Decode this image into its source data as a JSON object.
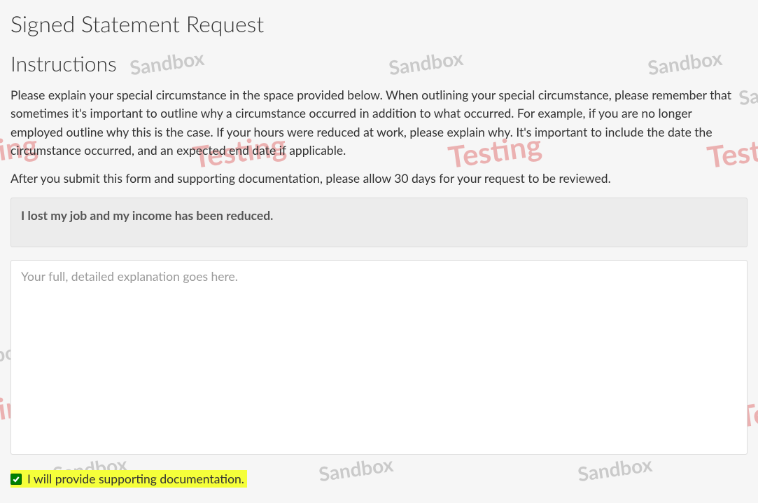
{
  "page_title": "Signed Statement Request",
  "instructions": {
    "heading": "Instructions",
    "para1": "Please explain your special circumstance in the space provided below. When outlining your special circumstance, please remember that sometimes it's important to outline why a circumstance occurred in addition to what occurred. For example, if you are no longer employed outline why this is the case. If your hours were reduced at work, please explain why. It's important to include the date the circumstance occurred, and an expected end date if applicable.",
    "para2": "After you submit this form and supporting documentation, please allow 30 days for your request to be reviewed."
  },
  "summary_box_text": "I lost my job and my income has been reduced.",
  "explanation_placeholder": "Your full, detailed explanation goes here.",
  "explanation_value": "",
  "checkbox": {
    "label": "I will provide supporting documentation.",
    "checked": true
  },
  "watermarks": {
    "sandbox": "Sandbox",
    "testing": "Testing"
  }
}
